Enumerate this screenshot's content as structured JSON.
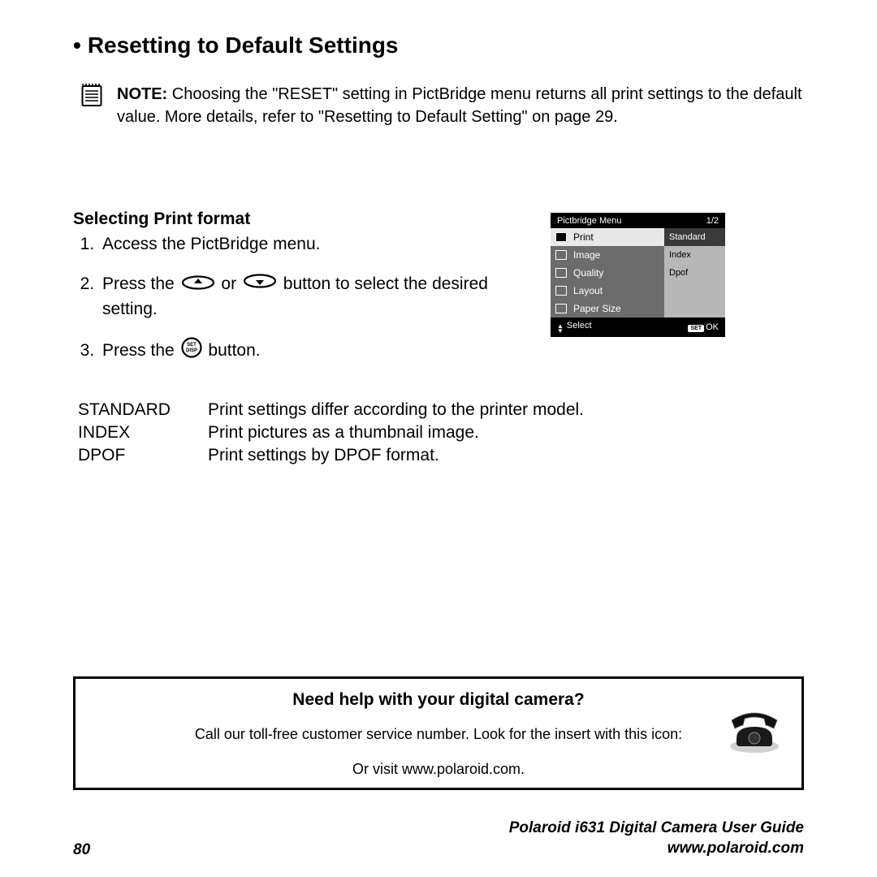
{
  "title_bullet": "•",
  "title": "Resetting to Default Settings",
  "note": {
    "label": "NOTE:",
    "text": "Choosing the \"RESET\" setting in PictBridge menu returns all print settings to the default value. More details, refer to \"Resetting to Default Setting\" on page 29."
  },
  "section_heading": "Selecting Print format",
  "steps": {
    "s1": "Access the PictBridge menu.",
    "s2a": "Press the",
    "s2b": "or",
    "s2c": "button to select the desired setting.",
    "s3a": "Press the",
    "s3b": "button."
  },
  "defs": {
    "standard": {
      "term": "STANDARD",
      "desc": "Print settings differ according to the printer model."
    },
    "index": {
      "term": "INDEX",
      "desc": "Print pictures as a thumbnail image."
    },
    "dpof": {
      "term": "DPOF",
      "desc": "Print settings by DPOF format."
    }
  },
  "menu": {
    "header_title": "Pictbridge Menu",
    "header_page": "1/2",
    "rows": [
      {
        "label": "Print",
        "value": "Standard"
      },
      {
        "label": "Image",
        "value": "Index"
      },
      {
        "label": "Quality",
        "value": "Dpof"
      },
      {
        "label": "Layout",
        "value": ""
      },
      {
        "label": "Paper Size",
        "value": ""
      }
    ],
    "footer_left": "Select",
    "footer_set": "SET",
    "footer_right": "OK"
  },
  "help": {
    "title": "Need help with your digital camera?",
    "line1": "Call our toll-free customer service number. Look for the insert with this icon:",
    "line2": "Or visit www.polaroid.com."
  },
  "footer": {
    "page": "80",
    "guide": "Polaroid i631 Digital Camera User Guide",
    "url": "www.polaroid.com"
  }
}
